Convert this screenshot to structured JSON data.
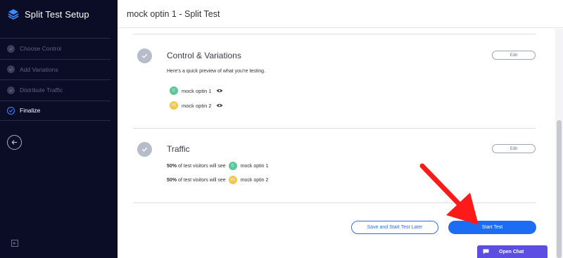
{
  "sidebar": {
    "app_title": "Split Test Setup",
    "steps": [
      {
        "label": "Choose Control",
        "state": "done"
      },
      {
        "label": "Add Variations",
        "state": "done"
      },
      {
        "label": "Distribute Traffic",
        "state": "done"
      },
      {
        "label": "Finalize",
        "state": "active"
      }
    ]
  },
  "header": {
    "title": "mock optin 1 - Split Test"
  },
  "sections": {
    "control": {
      "title": "Control & Variations",
      "description": "Here's a quick preview of what you're testing.",
      "edit_label": "Edit",
      "variants": [
        {
          "badge": "C",
          "name": "mock optin 1",
          "color": "#5cc69a"
        },
        {
          "badge": "V1",
          "name": "mock optin 2",
          "color": "#f3c74a"
        }
      ]
    },
    "traffic": {
      "title": "Traffic",
      "edit_label": "Edit",
      "lines": [
        {
          "percent": "50%",
          "text": "of test visitors will see",
          "badge": "C",
          "name": "mock optin 1"
        },
        {
          "percent": "50%",
          "text": "of test visitors will see",
          "badge": "V1",
          "name": "mock optin 2"
        }
      ]
    }
  },
  "actions": {
    "save_later_label": "Save and Start Test Later",
    "start_label": "Start Test"
  },
  "chat": {
    "label": "Open Chat"
  },
  "colors": {
    "sidebar_bg": "#0b0d26",
    "primary": "#1b6ef3",
    "chat": "#5b4ee0",
    "arrow": "#ff1a1a"
  }
}
